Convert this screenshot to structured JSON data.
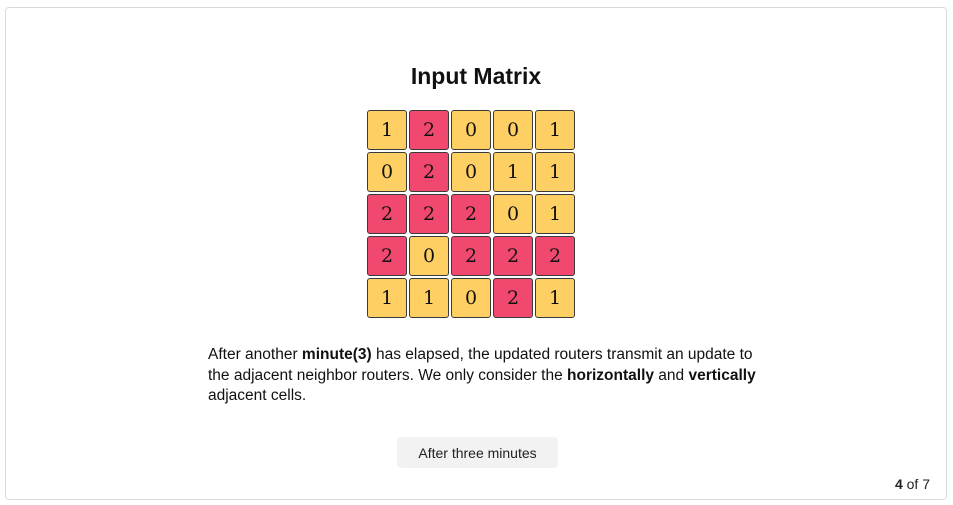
{
  "title": "Input Matrix",
  "colors": {
    "zero_one_cell": "#fecf63",
    "two_cell": "#f1486f"
  },
  "matrix": [
    [
      1,
      2,
      0,
      0,
      1
    ],
    [
      0,
      2,
      0,
      1,
      1
    ],
    [
      2,
      2,
      2,
      0,
      1
    ],
    [
      2,
      0,
      2,
      2,
      2
    ],
    [
      1,
      1,
      0,
      2,
      1
    ]
  ],
  "description": {
    "p1": "After another ",
    "b1": "minute(3)",
    "p2": " has elapsed, the updated routers transmit an update to the adjacent neighbor routers. We only consider the ",
    "b2": "horizontally",
    "p3": " and ",
    "b3": "vertically",
    "p4": " adjacent cells."
  },
  "step_button_label": "After three minutes",
  "pager": {
    "current": "4",
    "separator": " of ",
    "total": "7"
  }
}
